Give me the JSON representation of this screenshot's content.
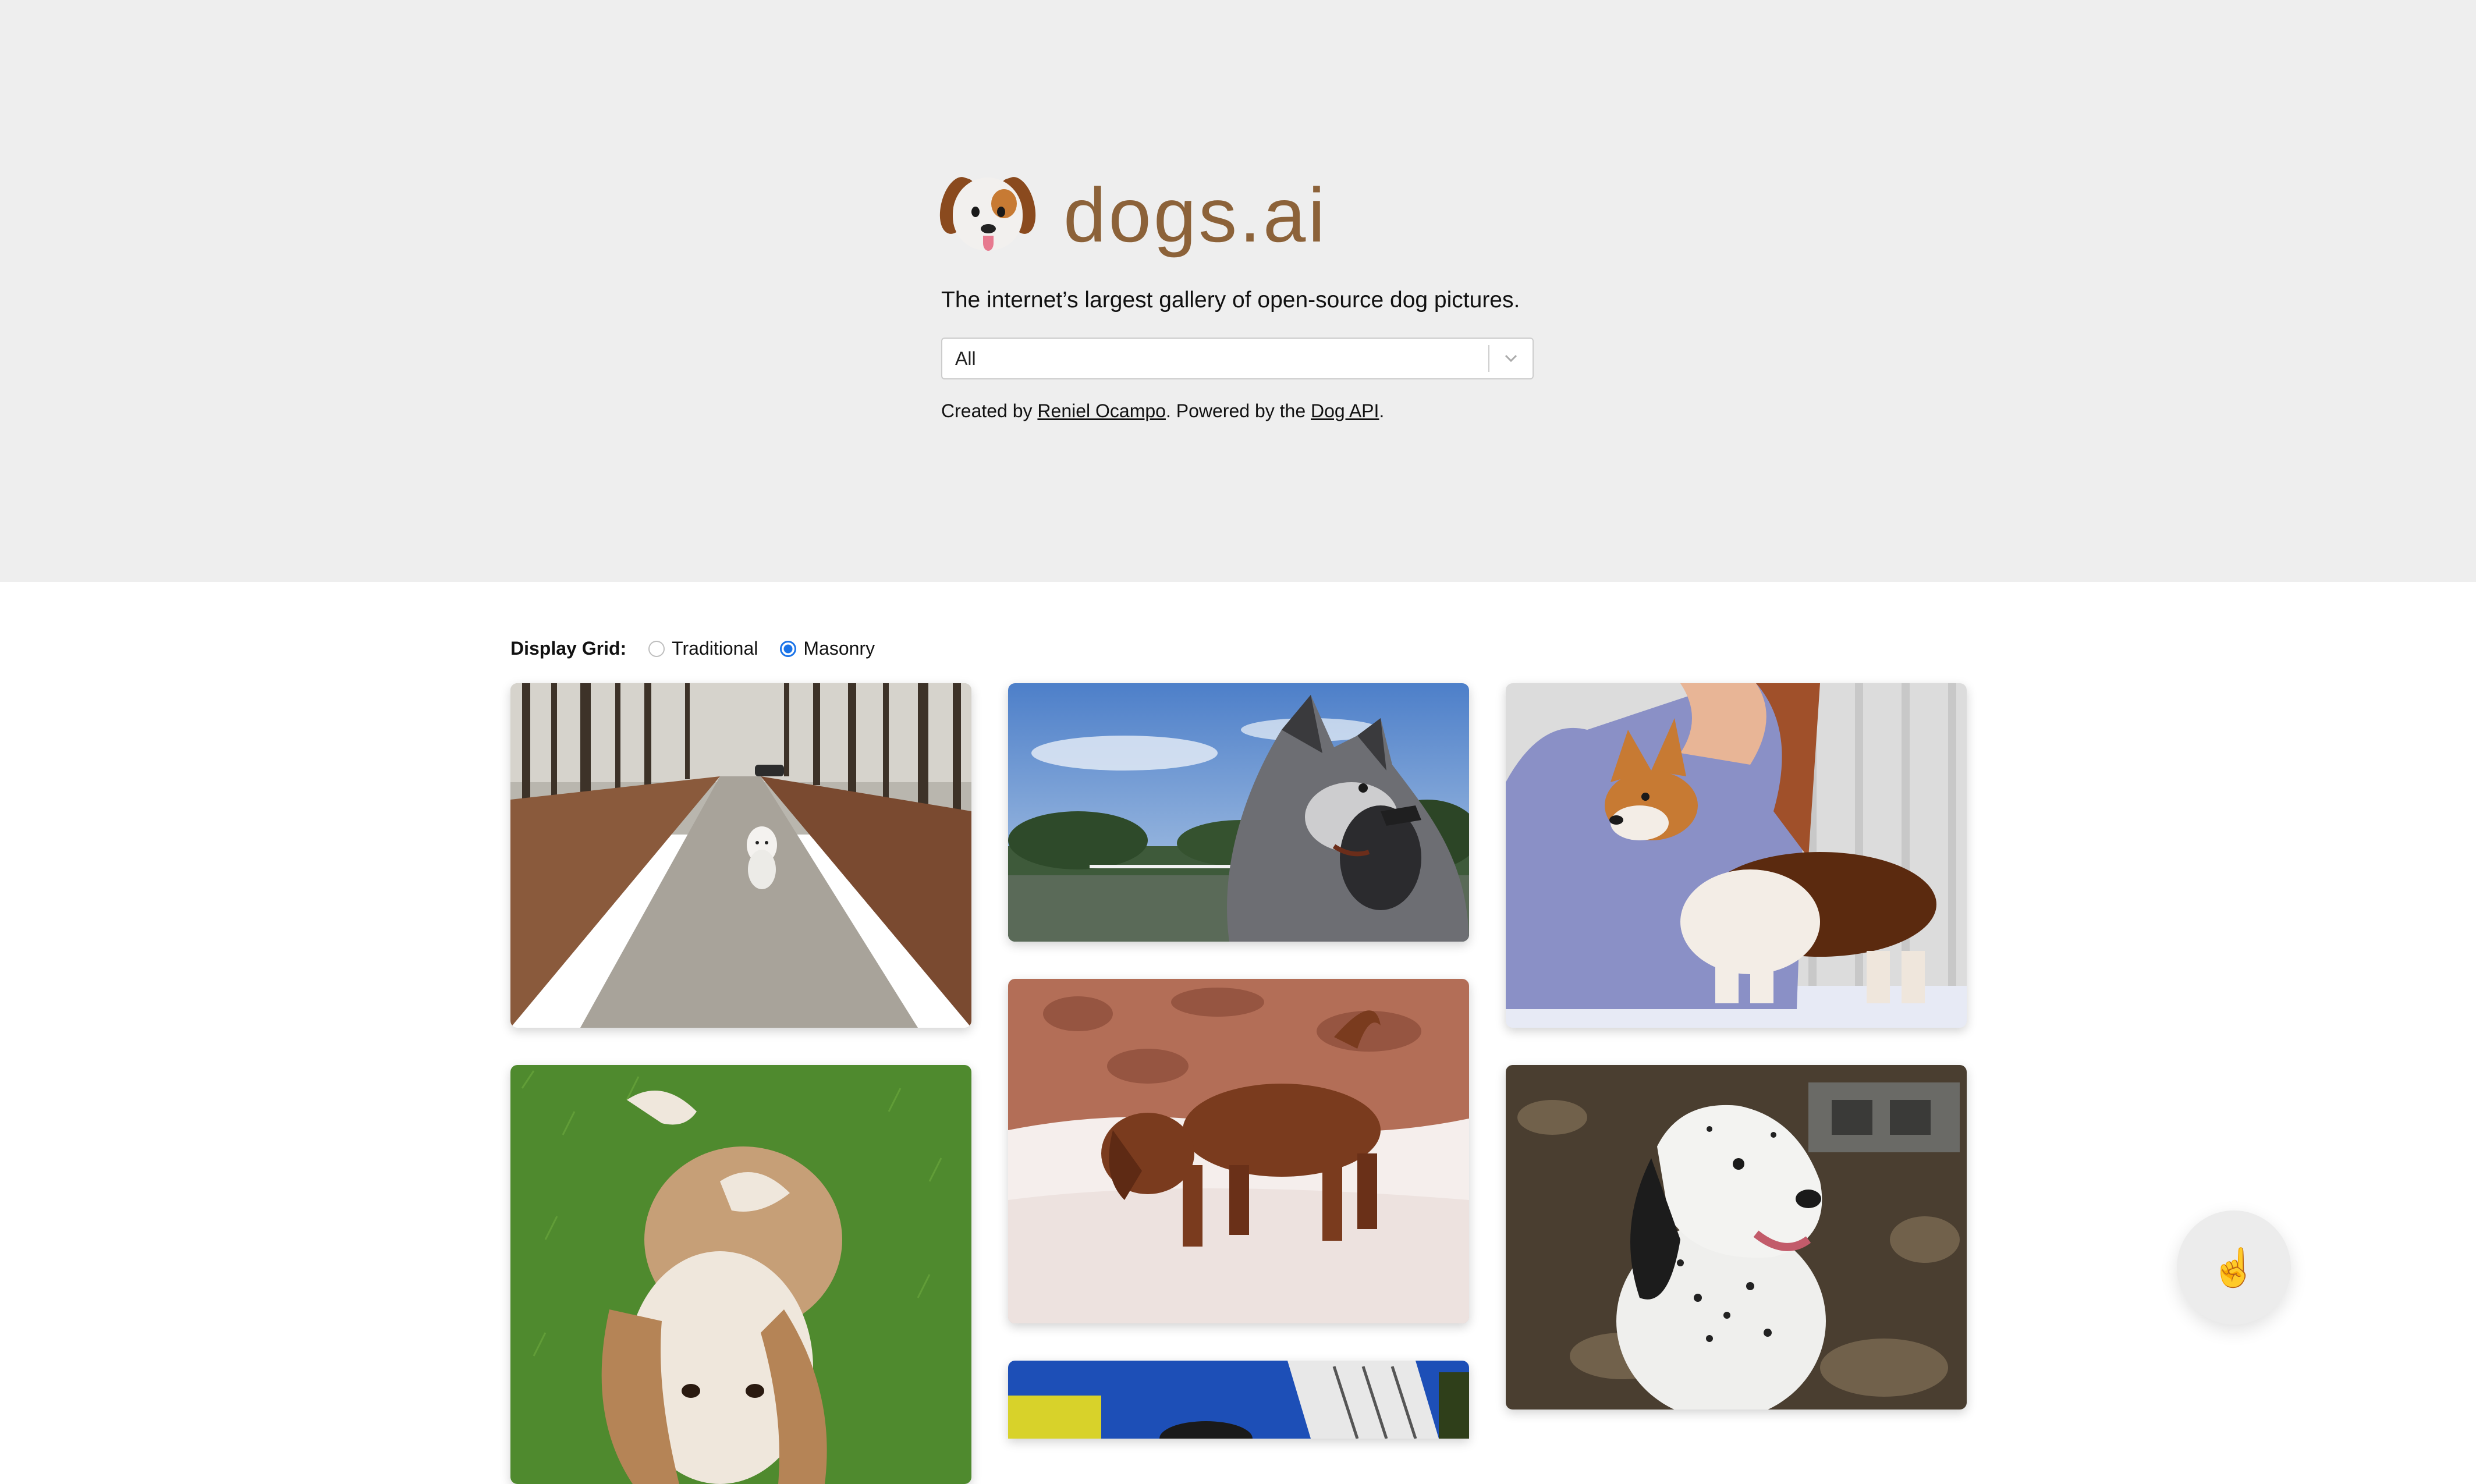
{
  "brand": {
    "name": "dogs.ai",
    "logo_icon": "dog-face-emoji"
  },
  "tagline": "The internet’s largest gallery of open-source dog pictures.",
  "breed_select": {
    "value": "All"
  },
  "credits": {
    "prefix": "Created by ",
    "author": "Reniel Ocampo",
    "middle": ". Powered by the ",
    "api": "Dog API",
    "suffix": "."
  },
  "display_grid": {
    "label": "Display Grid:",
    "options": [
      "Traditional",
      "Masonry"
    ],
    "selected": "Masonry"
  },
  "gallery": {
    "photos": [
      {
        "subject": "white puppy on forest path"
      },
      {
        "subject": "merle australian shepherd by pond"
      },
      {
        "subject": "corgi on show table"
      },
      {
        "subject": "basset hound puppy on grass"
      },
      {
        "subject": "brown dog in snow"
      },
      {
        "subject": "english setter in shade"
      },
      {
        "subject": "pool scene"
      }
    ]
  },
  "fab": {
    "icon": "pointing-up-hand-icon",
    "glyph": "☝️"
  },
  "colors": {
    "hero_bg": "#eeeeee",
    "brand_text": "#8c6239",
    "radio_selected": "#1a73e8"
  }
}
